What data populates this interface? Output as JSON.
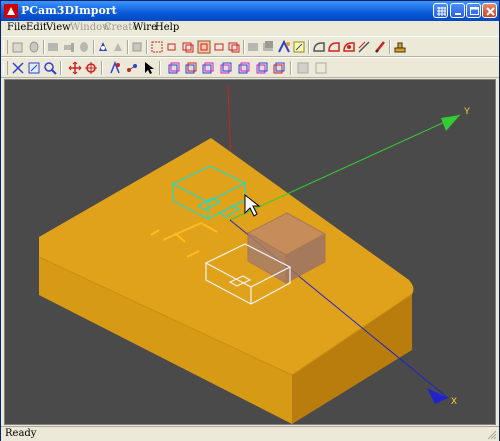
{
  "window": {
    "title": "PCam3DImport"
  },
  "menu": [
    {
      "label": "File",
      "enabled": true
    },
    {
      "label": "Edit",
      "enabled": true
    },
    {
      "label": "View",
      "enabled": true
    },
    {
      "label": "Window",
      "enabled": false
    },
    {
      "label": "Create",
      "enabled": false
    },
    {
      "label": "Wire",
      "enabled": true
    },
    {
      "label": "Help",
      "enabled": true
    }
  ],
  "viewport": {
    "axis_labels": {
      "y": "Y",
      "x": "X"
    },
    "colors": {
      "background": "#4a4a4a",
      "part": "#e0a21a",
      "y_axis": "#33cc33",
      "x_axis": "#2222cc",
      "z_axis": "#cc2222",
      "selected_box": "#00e5e5",
      "white_box": "#f2f2f2"
    }
  },
  "toolbar1": {
    "icons": [
      "open-icon",
      "save-icon",
      "print-icon",
      "cut-icon",
      "copy-icon",
      "paste-icon",
      "undo-icon",
      "redo-icon",
      "delete-icon",
      "select-face-icon",
      "select-edge-icon",
      "select-vertex-icon",
      "select-solid-icon",
      "select-region-icon",
      "select-loop-icon",
      "grid-icon",
      "snap-icon",
      "measure-icon",
      "dimension-icon",
      "chamfer-icon",
      "fillet-icon",
      "offset-icon",
      "pen-icon",
      "export-icon"
    ]
  },
  "toolbar2": {
    "icons": [
      "zoom-extents-icon",
      "zoom-window-icon",
      "zoom-dynamic-icon",
      "pan-icon",
      "center-icon",
      "rotate-icon",
      "orbit-icon",
      "pointer-icon",
      "view-top-icon",
      "view-front-icon",
      "view-left-icon",
      "view-right-icon",
      "view-back-icon",
      "view-bottom-icon",
      "view-iso-icon",
      "shade-icon",
      "wireframe-icon"
    ]
  },
  "status": {
    "text": "Ready"
  }
}
